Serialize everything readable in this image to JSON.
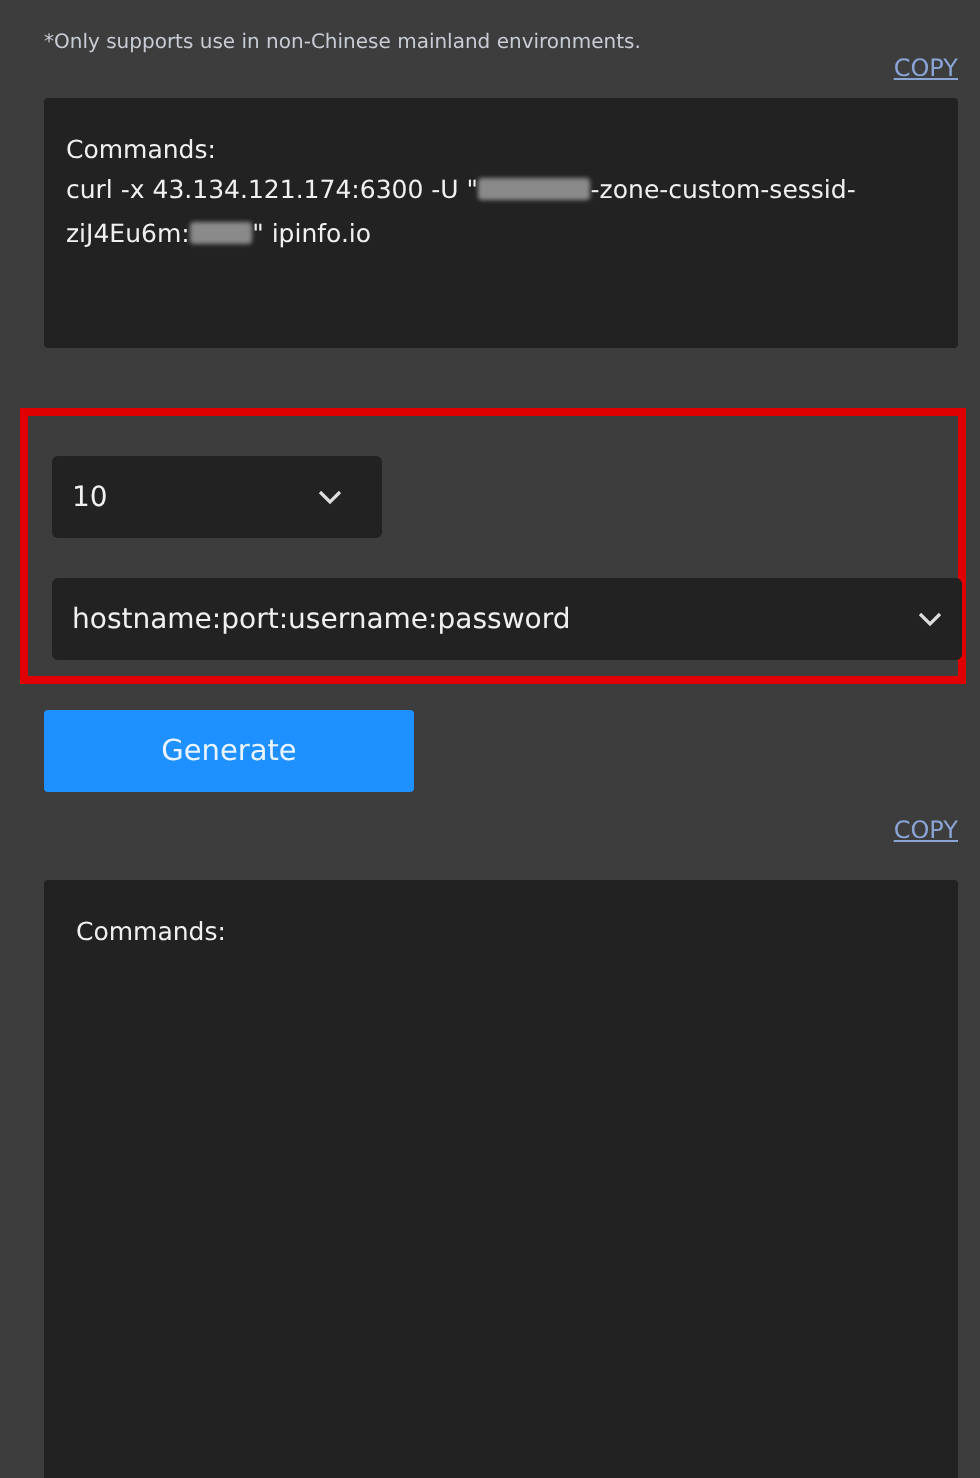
{
  "note": "*Only supports use in non-Chinese mainland environments.",
  "top_copy_link": "COPY",
  "command_box": {
    "label": "Commands:",
    "segments": [
      {
        "kind": "text",
        "text": "curl -x 43.134.121.174:6300 -U \""
      },
      {
        "kind": "redacted"
      },
      {
        "kind": "text",
        "text": "-zone-custom-sessid-ziJ4Eu6m:"
      },
      {
        "kind": "redacted"
      },
      {
        "kind": "text",
        "text": "\" ipinfo.io"
      }
    ]
  },
  "highlight": {
    "shown": true
  },
  "count_select": {
    "value": "10"
  },
  "format_select": {
    "value": "hostname:port:username:password"
  },
  "generate_button": "Generate",
  "bottom_copy_link": "COPY",
  "output_box": {
    "label": "Commands:"
  }
}
